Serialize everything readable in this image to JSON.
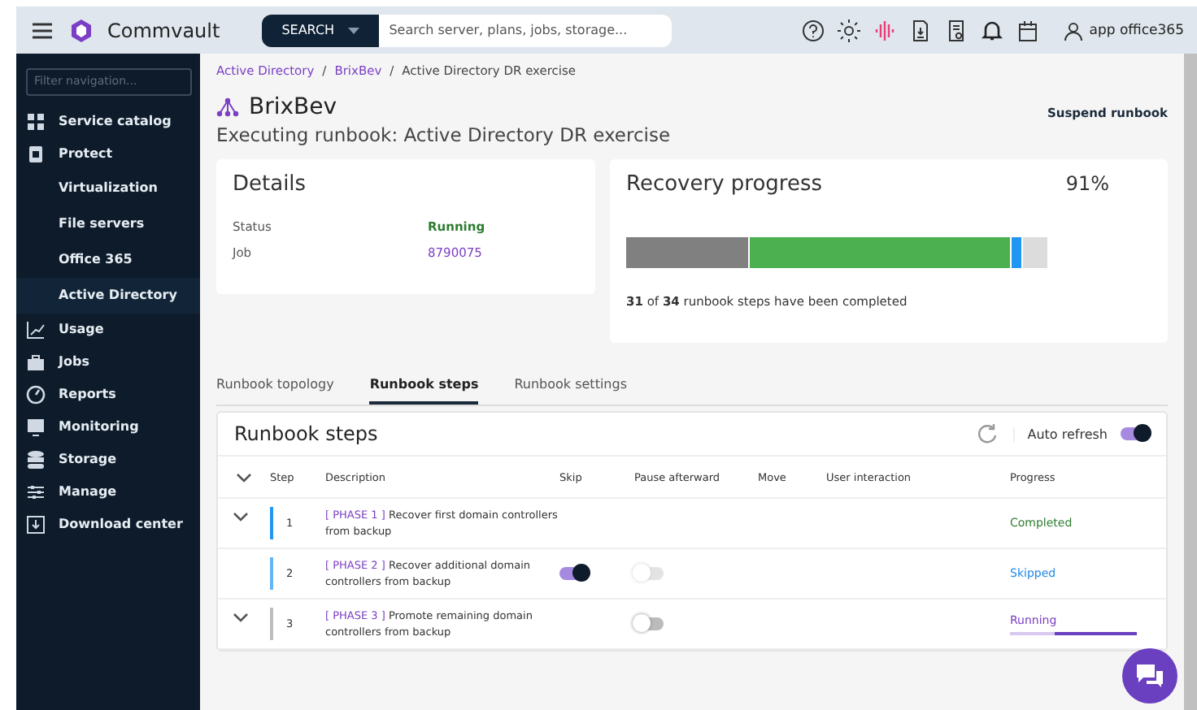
{
  "header": {
    "logo": "Commvault",
    "search_button": "SEARCH",
    "search": {
      "placeholder": "Search server, plans, jobs, storage..."
    },
    "user": "app office365"
  },
  "sidebar": {
    "filter": {
      "placeholder": "Filter navigation..."
    },
    "items": [
      {
        "label": "Service catalog",
        "selected": false
      },
      {
        "label": "Protect",
        "selected": false,
        "children": [
          {
            "label": "Virtualization",
            "selected": false
          },
          {
            "label": "File servers",
            "selected": false
          },
          {
            "label": "Office 365",
            "selected": false
          },
          {
            "label": "Active Directory",
            "selected": true
          }
        ]
      },
      {
        "label": "Usage",
        "selected": false
      },
      {
        "label": "Jobs",
        "selected": false
      },
      {
        "label": "Reports",
        "selected": false
      },
      {
        "label": "Monitoring",
        "selected": false
      },
      {
        "label": "Storage",
        "selected": false
      },
      {
        "label": "Manage",
        "selected": false
      },
      {
        "label": "Download center",
        "selected": false
      }
    ]
  },
  "breadcrumb": [
    {
      "label": "Active Directory",
      "kind": "link"
    },
    {
      "label": "/",
      "kind": "separator"
    },
    {
      "label": "BrixBev",
      "kind": "link"
    },
    {
      "label": "/",
      "kind": "separator"
    },
    {
      "label": "Active Directory DR exercise",
      "kind": "current"
    }
  ],
  "title": "BrixBev",
  "subtitle": "Executing runbook: Active Directory DR exercise",
  "action": "Suspend runbook",
  "details": {
    "title": "Details",
    "rows": [
      {
        "label": "Status",
        "value": "Running",
        "kind": "status"
      },
      {
        "label": "Job",
        "value": "8790075",
        "kind": "link"
      }
    ]
  },
  "recovery": {
    "title": "Recovery progress",
    "percent": "91%",
    "segments": [
      {
        "color": "#808080"
      },
      {
        "color": "#4caf50"
      },
      {
        "color": "#2196f3"
      },
      {
        "color": "#dcdcdc"
      }
    ],
    "summary": "**31** of **34** runbook steps have been completed"
  },
  "tabs": [
    {
      "label": "Runbook topology",
      "selected": false
    },
    {
      "label": "Runbook steps",
      "selected": true
    },
    {
      "label": "Runbook settings",
      "selected": false
    }
  ],
  "steps": {
    "title": "Runbook steps",
    "auto_refresh": {
      "label": "Auto refresh",
      "on": true
    },
    "columns": [
      "Step",
      "Description",
      "Skip",
      "Pause afterward",
      "Move",
      "User interaction",
      "Progress"
    ],
    "rows": [
      {
        "expandable": true,
        "step": "1",
        "phase": "[ PHASE 1 ]",
        "description": "Recover first domain controllers from backup",
        "color": "#2196f3",
        "skip": null,
        "pause": null,
        "progress": "Completed",
        "kind": "completed"
      },
      {
        "expandable": false,
        "step": "2",
        "phase": "[ PHASE 2 ]",
        "description": "Recover additional domain controllers from backup",
        "color": "#64b5f6",
        "skip": {
          "on": true,
          "disabled": false
        },
        "pause": {
          "on": false,
          "disabled": true
        },
        "progress": "Skipped",
        "kind": "skipped"
      },
      {
        "expandable": true,
        "step": "3",
        "phase": "[ PHASE 3 ]",
        "description": "Promote remaining domain controllers from backup",
        "color": "#bdbdbd",
        "skip": null,
        "pause": {
          "on": false,
          "disabled": false
        },
        "progress": "Running",
        "kind": "running"
      }
    ]
  }
}
